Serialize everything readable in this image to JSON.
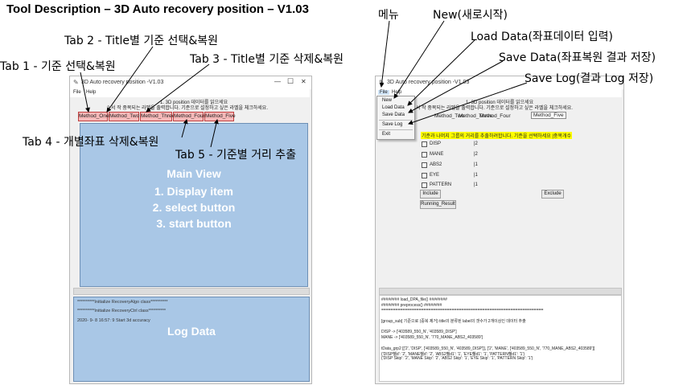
{
  "doc_title": "Tool Description – 3D Auto recovery position – V1.03",
  "callouts_left": {
    "tab1": "Tab 1 - 기준 선택&복원",
    "tab2": "Tab 2 - Title별 기준 선택&복원",
    "tab3": "Tab 3 - Title별 기준 삭제&복원",
    "tab4": "Tab 4 - 개별좌표 삭제&복원",
    "tab5": "Tab 5 - 기준별 거리 추출"
  },
  "callouts_right": {
    "menu": "메뉴",
    "new": "New(새로시작)",
    "load": "Load Data(좌표데이터 입력)",
    "save": "Save Data(좌표복원 결과 저장)",
    "savelog": "Save Log(결과 Log 저장)"
  },
  "left_window": {
    "title": "3D Auto recovery position -V1.03",
    "menu": [
      "File",
      "Help"
    ],
    "info_line1": "1. 3D position 데이터를 읽으세요",
    "info_line2": "2 서 작 중복되는 라벨을 출력합니다. 기준으로 설정하고 싶은 라벨을 체크하세요.",
    "tabs": [
      "Method_One",
      "Method_Two",
      "Method_Three",
      "Method_Four",
      "Method_Five"
    ],
    "main_view": {
      "heading": "Main View",
      "items": [
        "1. Display item",
        "2. select button",
        "3. start  button"
      ]
    },
    "log_lines": [
      "**********Initialize RecoveryAlgo class**********",
      "**********Initialize RecoveryCtrl class**********",
      "2020- 9- 8 16:57: 9  Start 3d accuracy"
    ],
    "log_label": "Log Data",
    "window_controls": [
      "—",
      "☐",
      "✕"
    ]
  },
  "right_window": {
    "title": "3D Auto recovery position -V1.03",
    "menu": [
      "File",
      "Help"
    ],
    "file_menu_items": [
      "New",
      "Load Data",
      "Save Data",
      "Save Log",
      "Exit"
    ],
    "info_line1": "1. 3D position 데이터를 읽으세요",
    "info_line2": "서 작 중복되는 라벨을 출력합니다. 기준으로 설정하고 싶은 라벨을 체크하세요.",
    "tabs": [
      "Method_Two",
      "Method_Three",
      "Method_Four",
      "Method_Five"
    ],
    "highlight_text": "기준과 나머지 그룹의 거리를 추출하려합니다. 기준을 선택하세요 |중복개수",
    "highlight_color": "#ffff00",
    "checkboxes": [
      {
        "label": "DISP",
        "count": "|2"
      },
      {
        "label": "MANE",
        "count": "|2"
      },
      {
        "label": "ABS2",
        "count": "|1"
      },
      {
        "label": "EYE",
        "count": "|1"
      },
      {
        "label": "PATTERN",
        "count": "|1"
      }
    ],
    "include_label": "Include",
    "exclude_label": "Exclude",
    "running_label": "Running_Result",
    "log_lines": [
      "######## load_DPA_file() ########",
      "######## preprocess() ########",
      "=====================================================================",
      "[group_sub] 기준으로 (중복 제거) title의 분류된 label의 갯수가 2개이상인 데이터 추출",
      "DISP -> ['403589_550_N', '403589_DISP']",
      "MANE -> ['403589_550_N', '770_MANE_ABS2_403589']",
      "tData_grp2 [['2', 'DISP', ['403589_550_N', '403589_DISP']], ['2', 'MANE', ['403589_550_N', '770_MANE_ABS2_403589']]",
      "{'DISP췖d': '2', 'MANE췖d': '2', 'ABS2췖d1': '1', 'EYE췖d1': '1', 'PATTERN췖d1': '1'}",
      " {'DISP Skip': '2', 'MANE Skip': '2', 'ABS2 Skip': '1', 'EYE Skip': '1', 'PATTERN Skip': '1'}"
    ]
  },
  "colors": {
    "tab_fill": "#f6b9b9",
    "tab_border": "#c04040",
    "panel_blue": "#a9c7e6",
    "highlight": "#ffff00"
  }
}
